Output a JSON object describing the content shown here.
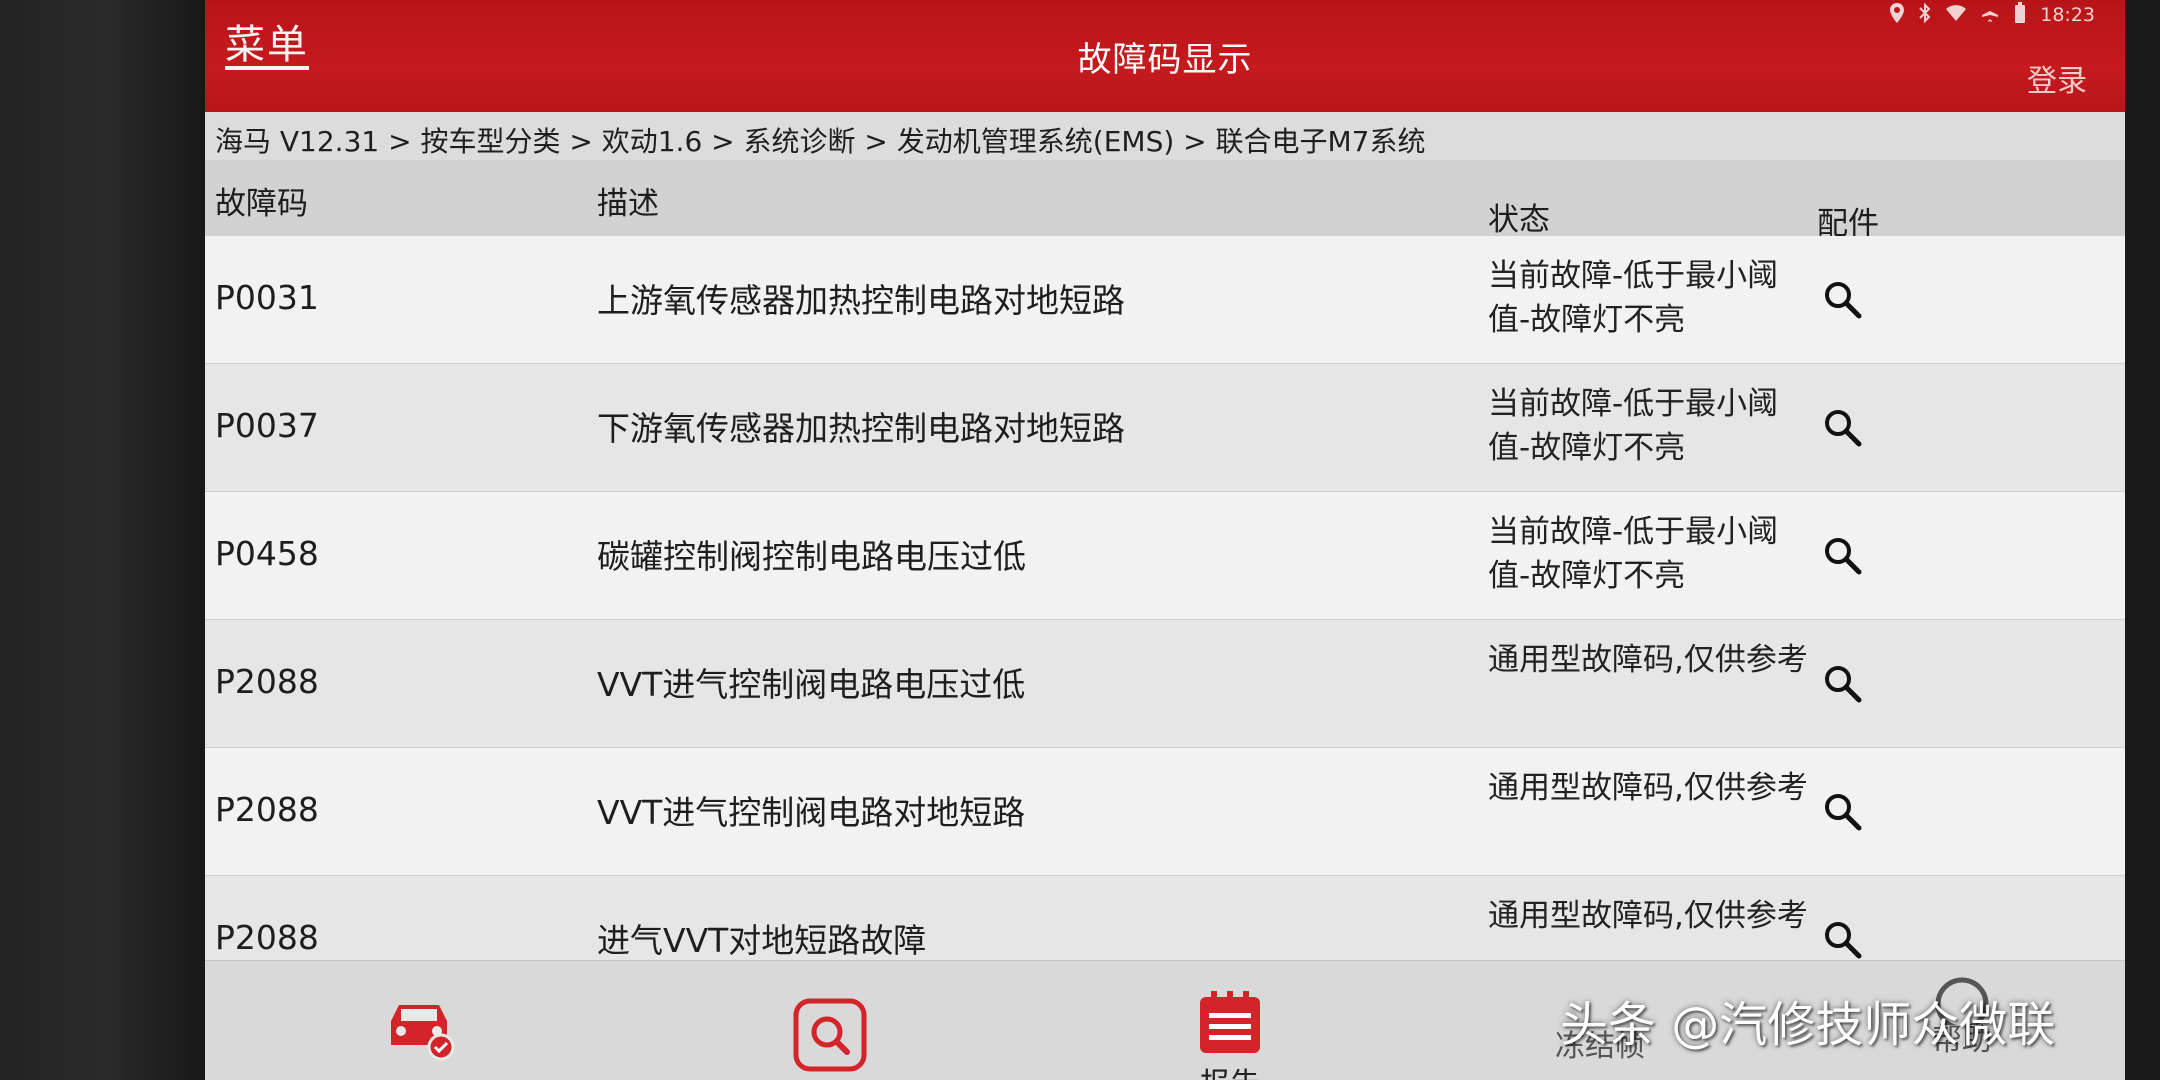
{
  "status_bar": {
    "time": "18:23"
  },
  "header": {
    "menu_label": "菜单",
    "title": "故障码显示",
    "login_label": "登录",
    "colors": {
      "header_red": "#c51a1e",
      "icon_red": "#d3242a"
    }
  },
  "breadcrumb": "海马 V12.31 > 按车型分类 > 欢动1.6 > 系统诊断 > 发动机管理系统(EMS) > 联合电子M7系统",
  "table": {
    "columns": [
      "故障码",
      "描述",
      "状态",
      "配件"
    ],
    "rows": [
      {
        "code": "P0031",
        "description": "上游氧传感器加热控制电路对地短路",
        "status": "当前故障-低于最小阈值-故障灯不亮",
        "part_icon": "search-icon"
      },
      {
        "code": "P0037",
        "description": "下游氧传感器加热控制电路对地短路",
        "status": "当前故障-低于最小阈值-故障灯不亮",
        "part_icon": "search-icon"
      },
      {
        "code": "P0458",
        "description": "碳罐控制阀控制电路电压过低",
        "status": "当前故障-低于最小阈值-故障灯不亮",
        "part_icon": "search-icon"
      },
      {
        "code": "P2088",
        "description": "VVT进气控制阀电路电压过低",
        "status": "通用型故障码,仅供参考",
        "part_icon": "search-icon"
      },
      {
        "code": "P2088",
        "description": "VVT进气控制阀电路对地短路",
        "status": "通用型故障码,仅供参考",
        "part_icon": "search-icon"
      },
      {
        "code": "P2088",
        "description": "进气VVT对地短路故障",
        "status": "通用型故障码,仅供参考",
        "part_icon": "search-icon"
      }
    ]
  },
  "toolbar": {
    "items": [
      {
        "icon": "car-check-icon",
        "label": ""
      },
      {
        "icon": "search-icon",
        "label": ""
      },
      {
        "icon": "report-icon",
        "label": "报告"
      },
      {
        "icon": "freeze-frame-icon",
        "label": "冻结帧"
      },
      {
        "icon": "help-icon",
        "label": "帮助"
      }
    ]
  },
  "watermark": "头条 @汽修技师众微联"
}
